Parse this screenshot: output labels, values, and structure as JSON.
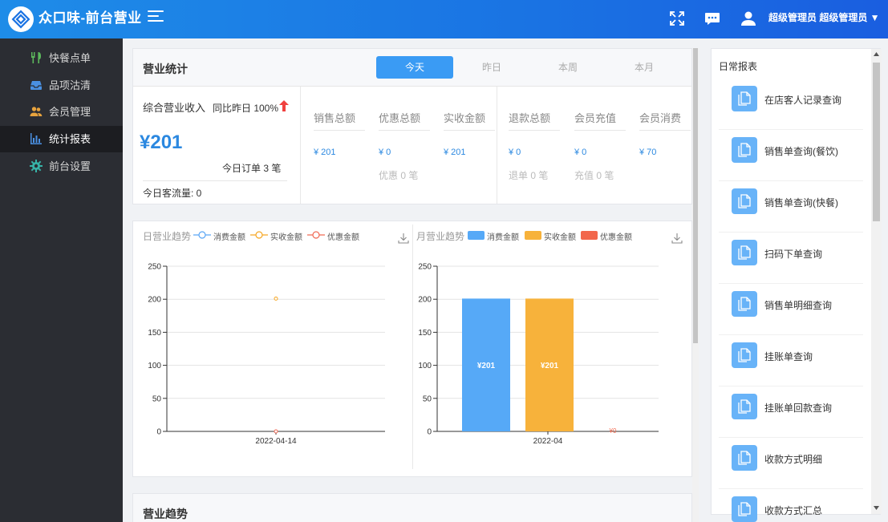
{
  "header": {
    "app_title": "众口味-前台营业",
    "user_label": "超级管理员 超级管理员 ▼"
  },
  "sidebar": {
    "items": [
      {
        "label": "快餐点单",
        "icon": "utensils-icon",
        "color": "#5cb85c"
      },
      {
        "label": "品项沽清",
        "icon": "inbox-icon",
        "color": "#4a90e2"
      },
      {
        "label": "会员管理",
        "icon": "users-icon",
        "color": "#e8a33d"
      },
      {
        "label": "统计报表",
        "icon": "bar-chart-icon",
        "color": "#4a90e2",
        "active": true
      },
      {
        "label": "前台设置",
        "icon": "gear-icon",
        "color": "#37b3a8"
      }
    ]
  },
  "stats": {
    "title": "营业统计",
    "tabs": [
      "今天",
      "昨日",
      "本周",
      "本月"
    ],
    "active_tab": "今天",
    "total_label": "综合营业收入",
    "compare_label": "同比昨日 100%",
    "total_amount": "¥201",
    "orders_today": "今日订单 3 笔",
    "traffic_today": "今日客流量: 0",
    "columns": [
      {
        "label": "销售总额",
        "value": "¥ 201",
        "sub": ""
      },
      {
        "label": "优惠总额",
        "value": "¥ 0",
        "sub": "优惠 0 笔"
      },
      {
        "label": "实收金额",
        "value": "¥ 201",
        "sub": ""
      },
      {
        "label": "退款总额",
        "value": "¥ 0",
        "sub": "退单 0 笔"
      },
      {
        "label": "会员充值",
        "value": "¥ 0",
        "sub": "充值 0 笔"
      },
      {
        "label": "会员消费",
        "value": "¥ 70",
        "sub": ""
      }
    ]
  },
  "daily_chart": {
    "title": "日营业趋势",
    "legend": [
      "消费金额",
      "实收金额",
      "优惠金额"
    ]
  },
  "monthly_chart": {
    "title": "月营业趋势",
    "legend": [
      "消费金额",
      "实收金额",
      "优惠金额"
    ]
  },
  "chart_data": [
    {
      "type": "line",
      "title": "日营业趋势",
      "categories": [
        "2022-04-14"
      ],
      "series": [
        {
          "name": "消费金额",
          "values": [
            null
          ],
          "color": "#5aa6f5"
        },
        {
          "name": "实收金额",
          "values": [
            201
          ],
          "color": "#f5a623"
        },
        {
          "name": "优惠金额",
          "values": [
            0
          ],
          "color": "#f06a55"
        }
      ],
      "ylim": [
        0,
        250
      ],
      "yticks": [
        0,
        50,
        100,
        150,
        200,
        250
      ],
      "grid": true
    },
    {
      "type": "bar",
      "title": "月营业趋势",
      "categories": [
        "2022-04"
      ],
      "series": [
        {
          "name": "消费金额",
          "values": [
            201
          ],
          "color": "#56a9f7",
          "label": "¥201"
        },
        {
          "name": "实收金额",
          "values": [
            201
          ],
          "color": "#f7b23b",
          "label": "¥201"
        },
        {
          "name": "优惠金额",
          "values": [
            0
          ],
          "color": "#f2674c",
          "label": "¥0"
        }
      ],
      "ylim": [
        0,
        250
      ],
      "yticks": [
        0,
        50,
        100,
        150,
        200,
        250
      ],
      "grid": true
    }
  ],
  "trend_section": {
    "title": "营业趋势"
  },
  "reports": {
    "title": "日常报表",
    "items": [
      "在店客人记录查询",
      "销售单查询(餐饮)",
      "销售单查询(快餐)",
      "扫码下单查询",
      "销售单明细查询",
      "挂账单查询",
      "挂账单回款查询",
      "收款方式明细",
      "收款方式汇总"
    ]
  }
}
